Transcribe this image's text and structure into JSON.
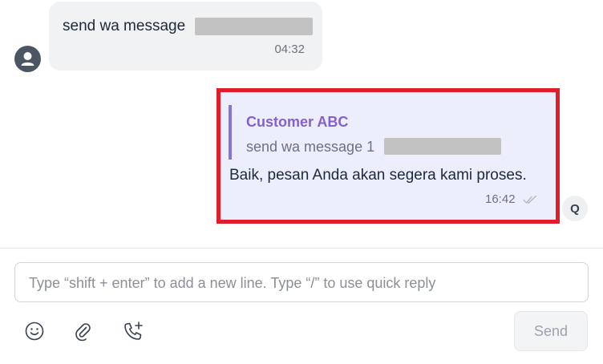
{
  "incoming": {
    "text": "send wa message",
    "time": "04:32",
    "avatar_icon": "user-icon"
  },
  "outgoing": {
    "quote_author": "Customer ABC",
    "quote_text": "send wa message 1",
    "body": "Baik, pesan Anda akan segera kami proses.",
    "time": "16:42",
    "status_icon": "double-check-icon",
    "avatar_initial": "Q"
  },
  "composer": {
    "placeholder": "Type “shift + enter” to add a new line. Type “/” to use quick reply",
    "send_label": "Send",
    "tools": [
      "emoji-icon",
      "attachment-icon",
      "call-add-icon"
    ]
  },
  "colors": {
    "highlight": "#e11d2a",
    "quote_accent": "#8b72d6",
    "outgoing_bg": "#eceefc",
    "incoming_bg": "#f1f2f4"
  }
}
